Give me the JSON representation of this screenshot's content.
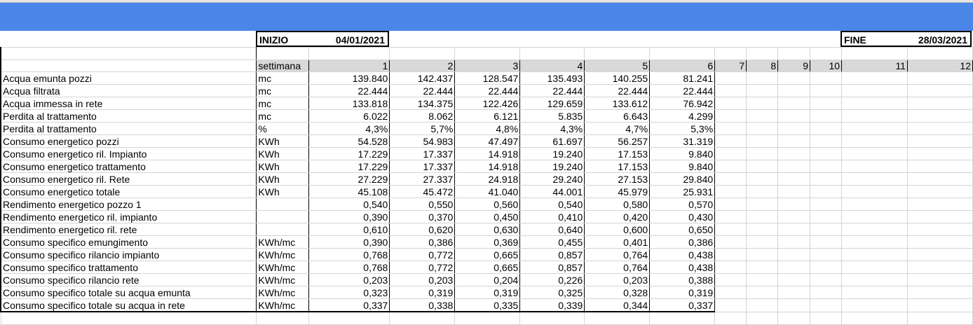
{
  "header": {
    "start_label": "INIZIO",
    "start_date": "04/01/2021",
    "end_label": "FINE",
    "end_date": "28/03/2021"
  },
  "colors": {
    "band": "#4a86e8",
    "week_header_bg": "#d9d9d9"
  },
  "table": {
    "week_label": "settimana",
    "weeks": [
      "1",
      "2",
      "3",
      "4",
      "5",
      "6",
      "7",
      "8",
      "9",
      "10",
      "11",
      "12"
    ],
    "rows": [
      {
        "label": "Acqua emunta pozzi",
        "unit": "mc",
        "values": [
          "139.840",
          "142.437",
          "128.547",
          "135.493",
          "140.255",
          "81.241"
        ]
      },
      {
        "label": "Acqua filtrata",
        "unit": "mc",
        "values": [
          "22.444",
          "22.444",
          "22.444",
          "22.444",
          "22.444",
          "22.444"
        ]
      },
      {
        "label": "Acqua immessa in rete",
        "unit": "mc",
        "values": [
          "133.818",
          "134.375",
          "122.426",
          "129.659",
          "133.612",
          "76.942"
        ]
      },
      {
        "label": "Perdita al trattamento",
        "unit": "mc",
        "values": [
          "6.022",
          "8.062",
          "6.121",
          "5.835",
          "6.643",
          "4.299"
        ]
      },
      {
        "label": "Perdita al trattamento",
        "unit": "%",
        "values": [
          "4,3%",
          "5,7%",
          "4,8%",
          "4,3%",
          "4,7%",
          "5,3%"
        ]
      },
      {
        "label": "Consumo energetico pozzi",
        "unit": "KWh",
        "values": [
          "54.528",
          "54.983",
          "47.497",
          "61.697",
          "56.257",
          "31.319"
        ]
      },
      {
        "label": "Consumo energetico ril. Impianto",
        "unit": "KWh",
        "values": [
          "17.229",
          "17.337",
          "14.918",
          "19.240",
          "17.153",
          "9.840"
        ]
      },
      {
        "label": "Consumo energetico trattamento",
        "unit": "KWh",
        "values": [
          "17.229",
          "17.337",
          "14.918",
          "19.240",
          "17.153",
          "9.840"
        ]
      },
      {
        "label": "Consumo energetico ril. Rete",
        "unit": "KWh",
        "values": [
          "27.229",
          "27.337",
          "24.918",
          "29.240",
          "27.153",
          "29.840"
        ]
      },
      {
        "label": "Consumo energetico totale",
        "unit": "KWh",
        "values": [
          "45.108",
          "45.472",
          "41.040",
          "44.001",
          "45.979",
          "25.931"
        ]
      },
      {
        "label": "Rendimento energetico pozzo 1",
        "unit": "",
        "values": [
          "0,540",
          "0,550",
          "0,560",
          "0,540",
          "0,580",
          "0,570"
        ]
      },
      {
        "label": "Rendimento energetico ril. impianto",
        "unit": "",
        "values": [
          "0,390",
          "0,370",
          "0,450",
          "0,410",
          "0,420",
          "0,430"
        ]
      },
      {
        "label": "Rendimento energetico ril. rete",
        "unit": "",
        "values": [
          "0,610",
          "0,620",
          "0,630",
          "0,640",
          "0,600",
          "0,650"
        ]
      },
      {
        "label": "Consumo specifico emungimento",
        "unit": "KWh/mc",
        "values": [
          "0,390",
          "0,386",
          "0,369",
          "0,455",
          "0,401",
          "0,386"
        ]
      },
      {
        "label": "Consumo specifico rilancio impianto",
        "unit": "KWh/mc",
        "values": [
          "0,768",
          "0,772",
          "0,665",
          "0,857",
          "0,764",
          "0,438"
        ]
      },
      {
        "label": "Consumo specifico trattamento",
        "unit": "KWh/mc",
        "values": [
          "0,768",
          "0,772",
          "0,665",
          "0,857",
          "0,764",
          "0,438"
        ]
      },
      {
        "label": "Consumo specifico rilancio rete",
        "unit": "KWh/mc",
        "values": [
          "0,203",
          "0,203",
          "0,204",
          "0,226",
          "0,203",
          "0,388"
        ]
      },
      {
        "label": "Consumo specifico totale su acqua emunta",
        "unit": "KWh/mc",
        "values": [
          "0,323",
          "0,319",
          "0,319",
          "0,325",
          "0,328",
          "0,319"
        ]
      },
      {
        "label": "Consumo specifico totale su acqua in rete",
        "unit": "KWh/mc",
        "values": [
          "0,337",
          "0,338",
          "0,335",
          "0,339",
          "0,344",
          "0,337"
        ]
      }
    ]
  }
}
